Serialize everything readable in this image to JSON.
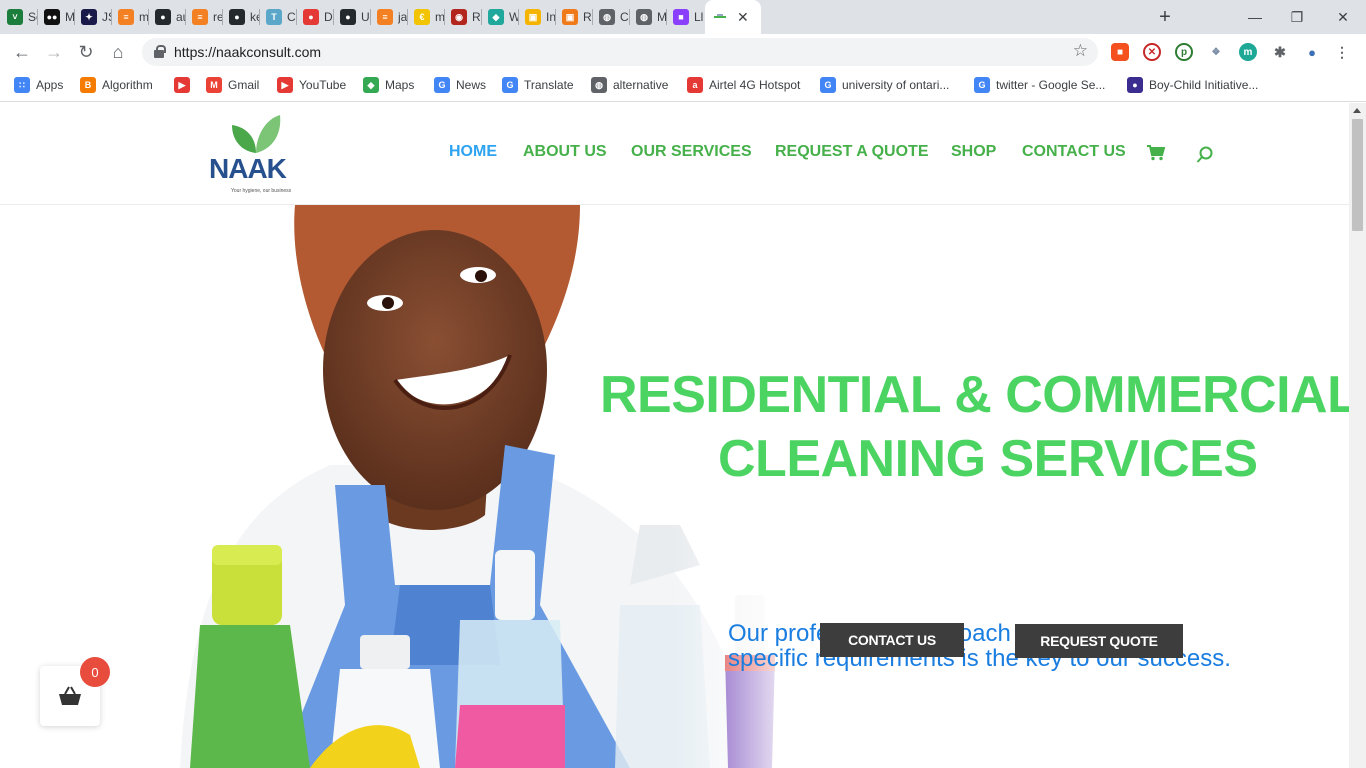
{
  "browser": {
    "tabs": [
      {
        "label": "Set",
        "color": "#1b7e3c",
        "glyph": "˅"
      },
      {
        "label": "Me",
        "color": "#111111",
        "glyph": "●●"
      },
      {
        "label": "JSC",
        "color": "#1a1a4a",
        "glyph": "✦"
      },
      {
        "label": "my",
        "color": "#f48024",
        "glyph": "≡"
      },
      {
        "label": "aut",
        "color": "#24292e",
        "glyph": "●"
      },
      {
        "label": "reg",
        "color": "#f48024",
        "glyph": "≡"
      },
      {
        "label": "kel",
        "color": "#24292e",
        "glyph": "●"
      },
      {
        "label": "Co",
        "color": "#5aa7c9",
        "glyph": "T"
      },
      {
        "label": "De",
        "color": "#e53935",
        "glyph": "●"
      },
      {
        "label": "Up",
        "color": "#24292e",
        "glyph": "●"
      },
      {
        "label": "jav",
        "color": "#f48024",
        "glyph": "≡"
      },
      {
        "label": "ma",
        "color": "#f2c400",
        "glyph": "€"
      },
      {
        "label": "Re",
        "color": "#b3261e",
        "glyph": "◉"
      },
      {
        "label": "We",
        "color": "#1fa89b",
        "glyph": "◆"
      },
      {
        "label": "Ins",
        "color": "#f5b400",
        "glyph": "▣"
      },
      {
        "label": "Ro",
        "color": "#f07a1a",
        "glyph": "▣"
      },
      {
        "label": "Cu",
        "color": "#5f6368",
        "glyph": "◍"
      },
      {
        "label": "Mk",
        "color": "#5f6368",
        "glyph": "◍"
      },
      {
        "label": "Llo",
        "color": "#8a3ffc",
        "glyph": "■"
      }
    ],
    "active_tab": {
      "label": "",
      "close": "✕"
    },
    "new_tab": "+",
    "window": {
      "minimize": "—",
      "restore": "❐",
      "close": "✕"
    },
    "url": "https://naakconsult.com",
    "bookmarks": [
      {
        "label": "Apps",
        "color": "#4285f4",
        "glyph": "∷"
      },
      {
        "label": "Algorithm",
        "color": "#f57c00",
        "glyph": "B"
      },
      {
        "label": "",
        "color": "#e53935",
        "glyph": "▶"
      },
      {
        "label": "Gmail",
        "color": "#ea4335",
        "glyph": "M"
      },
      {
        "label": "YouTube",
        "color": "#e53935",
        "glyph": "▶"
      },
      {
        "label": "Maps",
        "color": "#34a853",
        "glyph": "◆"
      },
      {
        "label": "News",
        "color": "#4285f4",
        "glyph": "G"
      },
      {
        "label": "Translate",
        "color": "#4285f4",
        "glyph": "G"
      },
      {
        "label": "alternative",
        "color": "#5f6368",
        "glyph": "◍"
      },
      {
        "label": "Airtel 4G Hotspot",
        "color": "#e53935",
        "glyph": "a"
      },
      {
        "label": "university of ontari...",
        "color": "#4285f4",
        "glyph": "G"
      },
      {
        "label": "twitter - Google Se...",
        "color": "#4285f4",
        "glyph": "G"
      },
      {
        "label": "Boy-Child Initiative...",
        "color": "#3b2d8f",
        "glyph": "●"
      }
    ]
  },
  "site": {
    "logo": {
      "wordmark": "NAAK",
      "tagline": "Your hygiene, our business"
    },
    "nav": [
      "HOME",
      "ABOUT US",
      "OUR SERVICES",
      "REQUEST A QUOTE",
      "SHOP",
      "CONTACT US"
    ],
    "hero": {
      "title_line1": "RESIDENTIAL & COMMERCIAL",
      "title_line2": "CLEANING SERVICES",
      "subtitle_line1": "Our professional approach to customers'",
      "subtitle_line2": "specific requirements is the key to our success.",
      "btn_contact": "CONTACT US",
      "btn_quote": "REQUEST QUOTE"
    },
    "cart_count": "0"
  },
  "colors": {
    "green": "#4cd463",
    "nav_green": "#46b04a",
    "nav_active": "#2ea3f2",
    "blue": "#1a7de0",
    "button": "#3d3d3d",
    "badge": "#e84c3d"
  }
}
